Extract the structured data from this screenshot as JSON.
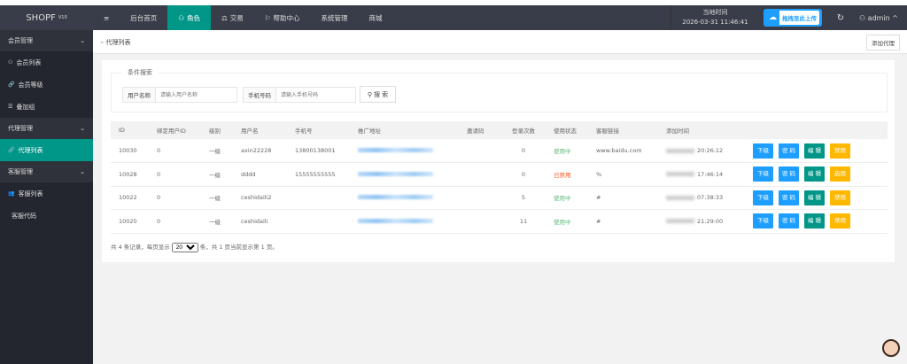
{
  "header": {
    "logo": "SHOPF",
    "logo_sup": "V10",
    "nav": [
      {
        "label": "≡",
        "icon": "menu-icon"
      },
      {
        "label": "后台首页"
      },
      {
        "label": "角色",
        "icon": "user-icon",
        "active": true
      },
      {
        "label": "交易",
        "icon": "scale-icon"
      },
      {
        "label": "帮助中心",
        "icon": "flag-icon"
      },
      {
        "label": "系统管理"
      },
      {
        "label": "商城"
      }
    ],
    "clock_label": "当地时间",
    "clock_value": "2026-03-31 11:46:41",
    "upload_label": "拖拽至此上传",
    "user": "admin"
  },
  "sidebar": {
    "sections": [
      {
        "label": "会员管理",
        "items": [
          "会员列表",
          "会员等级",
          "叠加组"
        ]
      },
      {
        "label": "代理管理",
        "items": [
          "代理列表"
        ]
      },
      {
        "label": "客服管理",
        "items": [
          "客服列表",
          "客服代码"
        ]
      }
    ]
  },
  "page": {
    "breadcrumb": "代理列表",
    "add_button": "添加代理"
  },
  "search": {
    "legend": "条件搜索",
    "username_label": "用户名称",
    "username_placeholder": "请输入用户名称",
    "phone_label": "手机号码",
    "phone_placeholder": "请输入手机号码",
    "button": "搜 索"
  },
  "table": {
    "headers": [
      "ID",
      "绑定用户ID",
      "级别",
      "用户名",
      "手机号",
      "推广地址",
      "邀请码",
      "登录次数",
      "使用状态",
      "客服链接",
      "添加时间",
      ""
    ],
    "rows": [
      {
        "id": "10030",
        "bind": "0",
        "level": "一级",
        "username": "axin22228",
        "phone": "13800138001",
        "invite": "",
        "logins": "0",
        "status": "使用中",
        "status_ok": true,
        "link": "www.baidu.com",
        "time": "20:26:12",
        "toggle": "禁用"
      },
      {
        "id": "10028",
        "bind": "0",
        "level": "一级",
        "username": "dddd",
        "phone": "15555555555",
        "invite": "",
        "logins": "0",
        "status": "已禁用",
        "status_ok": false,
        "link": "%",
        "time": "17:46:14",
        "toggle": "启用"
      },
      {
        "id": "10022",
        "bind": "0",
        "level": "一级",
        "username": "ceshidaili2",
        "phone": "",
        "invite": "",
        "logins": "5",
        "status": "使用中",
        "status_ok": true,
        "link": "#",
        "time": "07:38:33",
        "toggle": "禁用"
      },
      {
        "id": "10020",
        "bind": "0",
        "level": "一级",
        "username": "ceshidaili",
        "phone": "",
        "invite": "",
        "logins": "11",
        "status": "使用中",
        "status_ok": true,
        "link": "#",
        "time": "21:29:00",
        "toggle": "禁用"
      }
    ],
    "btn_sub": "下级",
    "btn_pwd": "密 码",
    "btn_edit": "编 辑"
  },
  "pager": {
    "prefix": "共 4 条记录，每页显示",
    "page_size": "20",
    "suffix": "条，共 1 页当前显示第 1 页。"
  }
}
